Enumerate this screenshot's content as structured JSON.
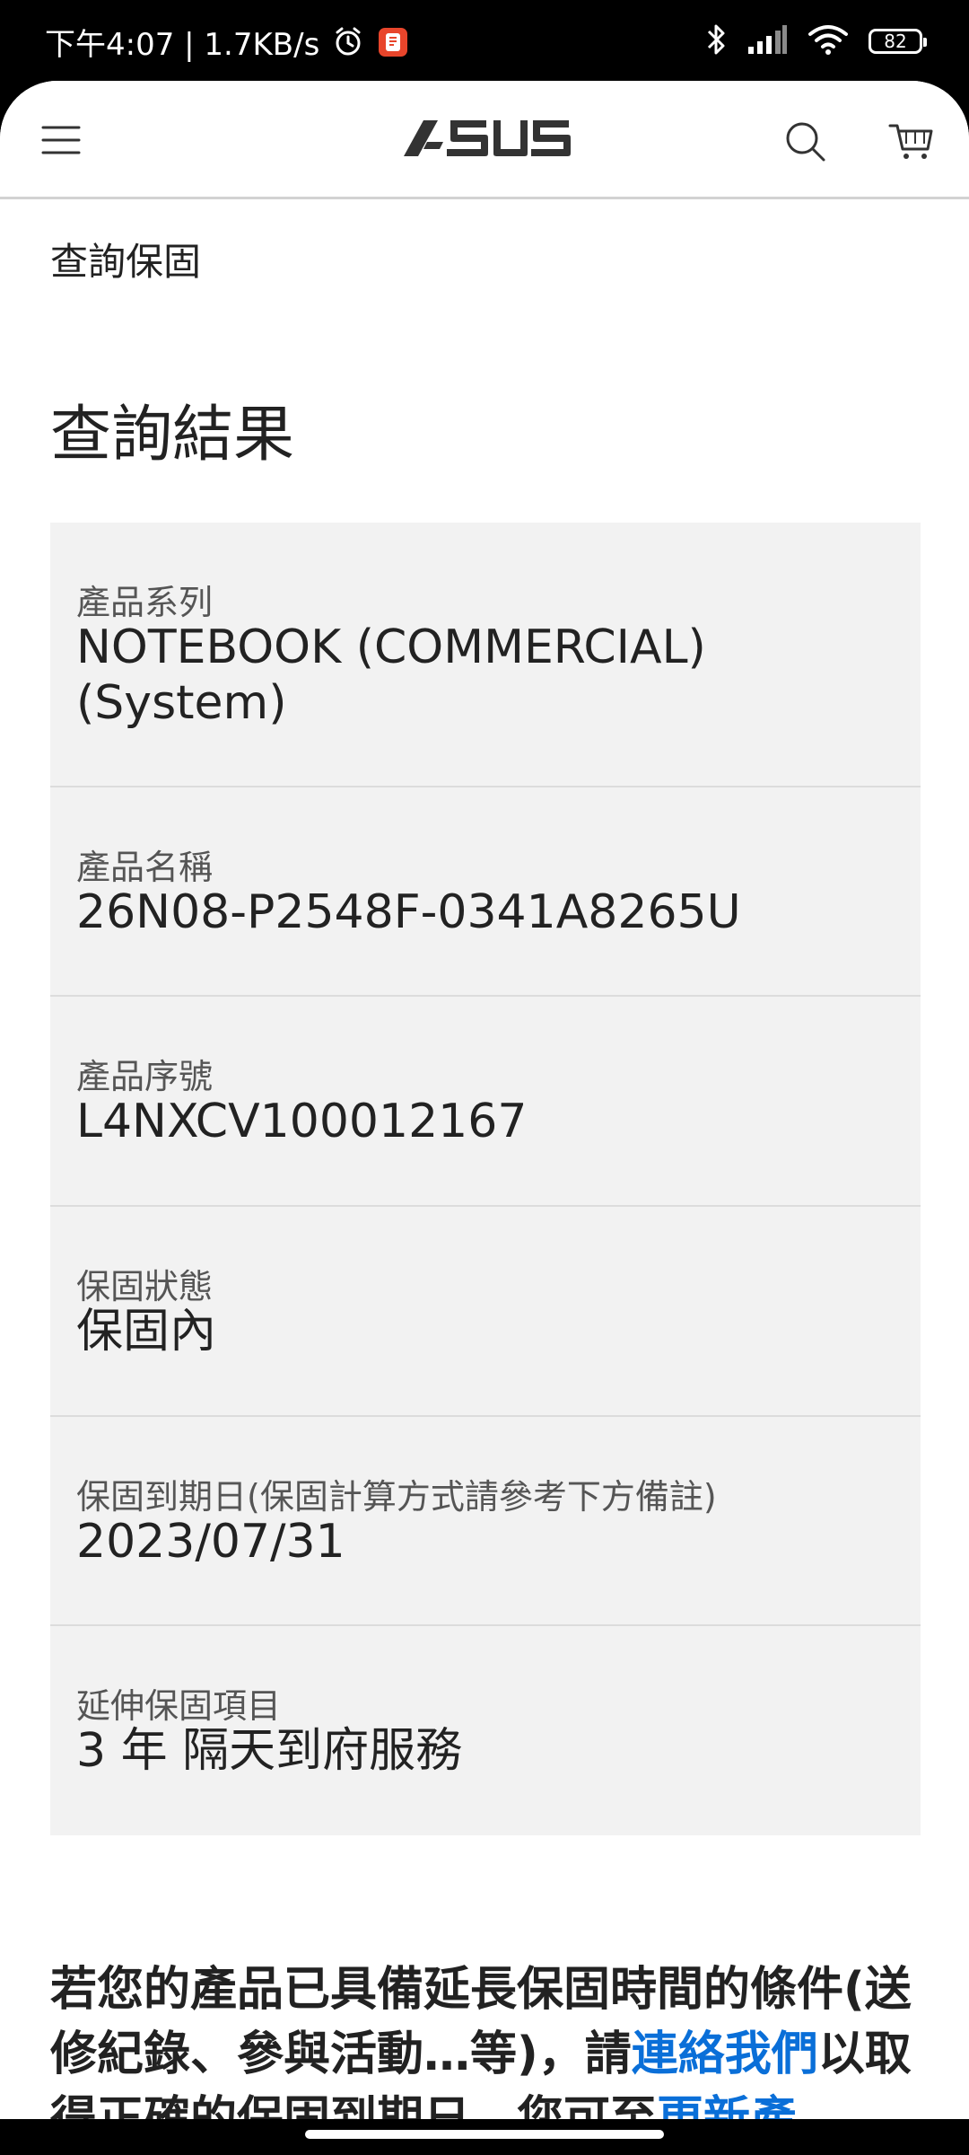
{
  "status_bar": {
    "time_speed": "下午4:07 | 1.7KB/s",
    "battery": "82",
    "icons": [
      "alarm-icon",
      "app-notification-icon",
      "bluetooth-icon",
      "signal-icon",
      "wifi-icon",
      "battery-icon"
    ]
  },
  "header": {
    "logo": "ASUS",
    "menu_icon": "hamburger-menu-icon",
    "search_icon": "search-icon",
    "cart_icon": "cart-icon"
  },
  "breadcrumb": "查詢保固",
  "page_title": "查詢結果",
  "results": [
    {
      "label": "產品系列",
      "value": "NOTEBOOK (COMMERCIAL) (System)"
    },
    {
      "label": "產品名稱",
      "value": "26N08-P2548F-0341A8265U"
    },
    {
      "label": "產品序號",
      "value": "L4NXCV100012167"
    },
    {
      "label": "保固狀態",
      "value": "保固內"
    },
    {
      "label": "保固到期日(保固計算方式請參考下方備註)",
      "value": "2023/07/31"
    },
    {
      "label": "延伸保固項目",
      "value": "3 年 隔天到府服務"
    }
  ],
  "notice": {
    "text_before_link": "若您的產品已具備延長保固時間的條件(送修紀錄、參與活動…等)，請",
    "contact_link": "連絡我們",
    "text_after_link": "以取得正確的保固到期日，您可至",
    "update_link": "更新產"
  },
  "colors": {
    "link": "#0a6fd8",
    "card_background": "#f2f2f2",
    "text": "#222222"
  }
}
